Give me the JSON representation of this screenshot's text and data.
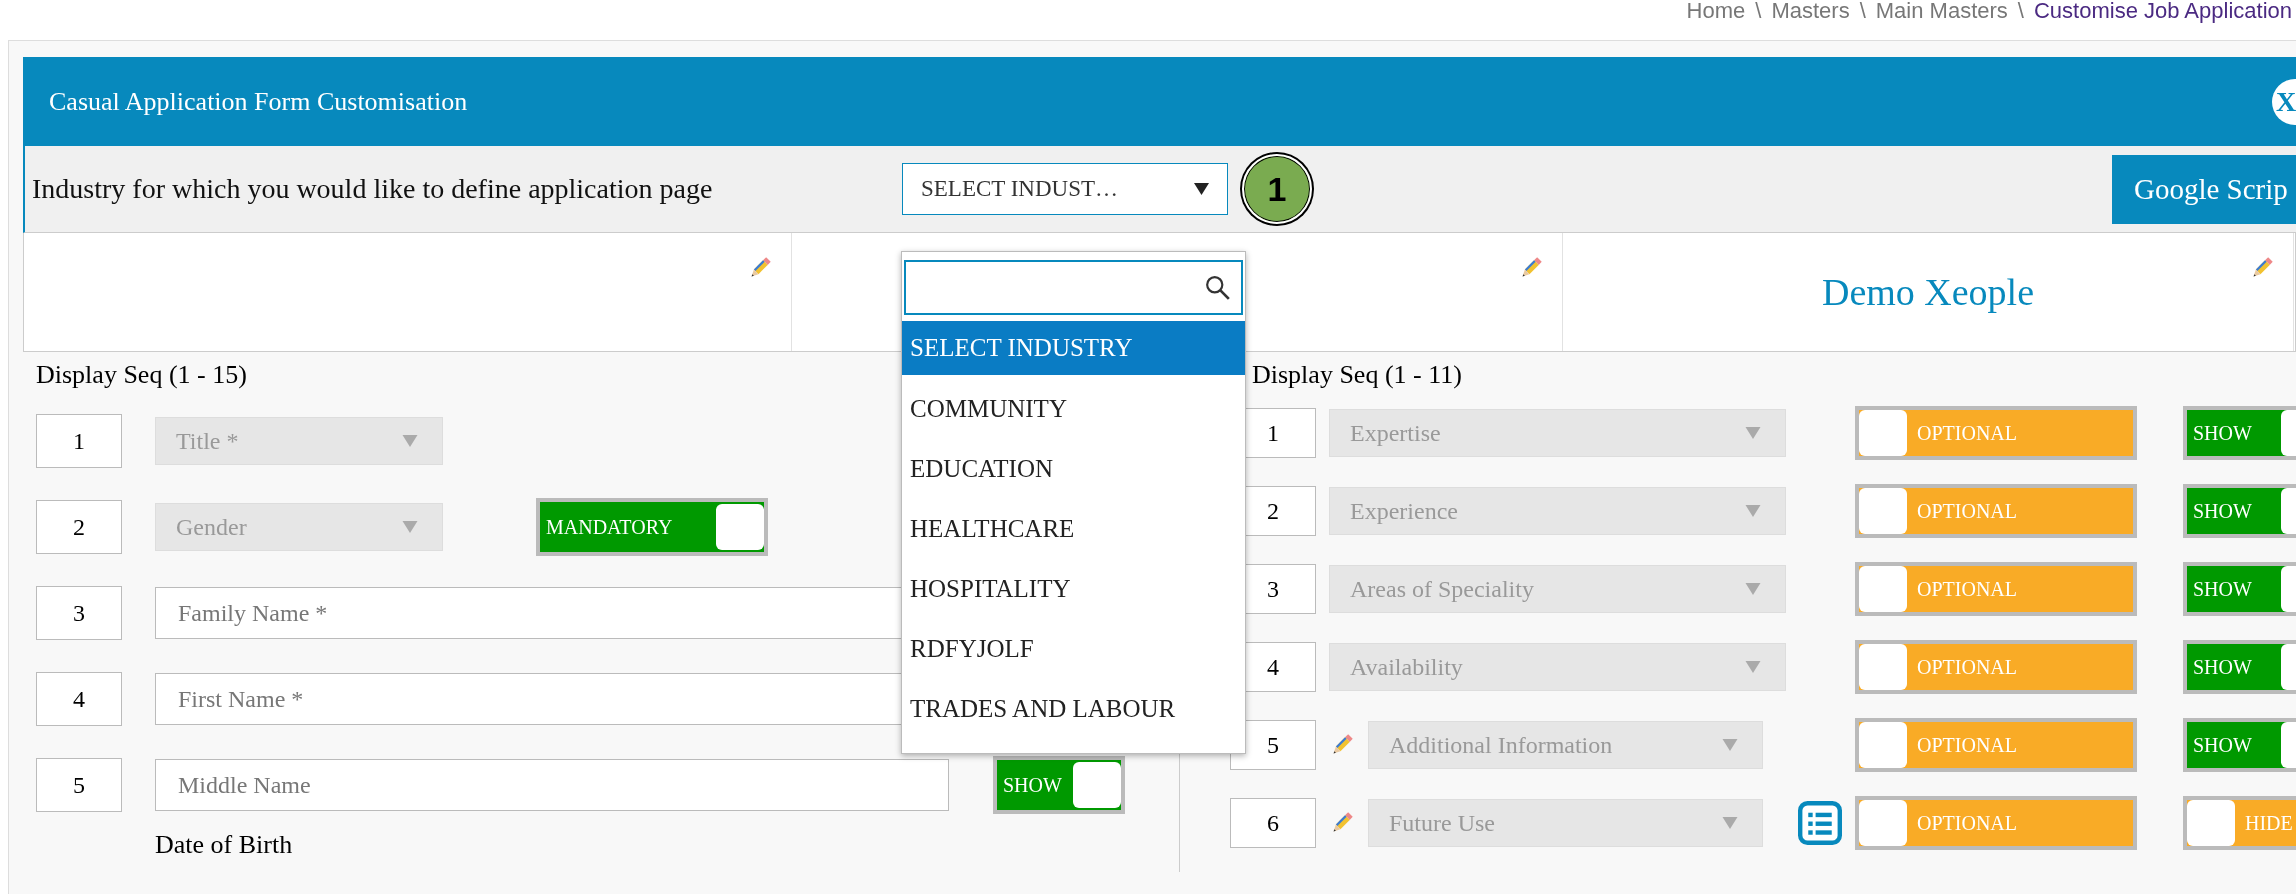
{
  "breadcrumb": [
    {
      "kind": "link",
      "label": "Home",
      "current": false
    },
    {
      "kind": "separator",
      "label": "\\"
    },
    {
      "kind": "link",
      "label": "Masters",
      "current": false
    },
    {
      "kind": "separator",
      "label": "\\"
    },
    {
      "kind": "link",
      "label": "Main Masters",
      "current": false
    },
    {
      "kind": "separator",
      "label": "\\"
    },
    {
      "kind": "link",
      "label": "Customise Job Application",
      "current": true
    }
  ],
  "panel": {
    "title": "Casual Application Form Customisation",
    "close": "X"
  },
  "industry": {
    "label": "Industry for which you would like to define application page",
    "value": "SELECT INDUST…",
    "expanded": true,
    "step": "1",
    "options": [
      {
        "label": "SELECT INDUSTRY",
        "selected": true
      },
      {
        "label": "COMMUNITY",
        "selected": false
      },
      {
        "label": "EDUCATION",
        "selected": false
      },
      {
        "label": "HEALTHCARE",
        "selected": false
      },
      {
        "label": "HOSPITALITY",
        "selected": false
      },
      {
        "label": "RDFYJOLF",
        "selected": false
      },
      {
        "label": "TRADES AND LABOUR",
        "selected": false
      }
    ]
  },
  "action_button": "Google Scrip",
  "header_cells": [
    {
      "kind": "blank"
    },
    {
      "kind": "blank"
    },
    {
      "kind": "title",
      "title": "Demo Xeople"
    }
  ],
  "left": {
    "heading": "Display Seq (1 - 15)",
    "rows": [
      {
        "seq": "1",
        "label": "Title *",
        "kind": "select"
      },
      {
        "seq": "2",
        "label": "Gender",
        "kind": "select",
        "requirement": {
          "text": "MANDATORY",
          "on": true
        }
      },
      {
        "seq": "3",
        "placeholder": "Family Name *",
        "kind": "text"
      },
      {
        "seq": "4",
        "placeholder": "First Name *",
        "kind": "text"
      },
      {
        "seq": "5",
        "placeholder": "Middle Name",
        "kind": "short_text",
        "visibility": {
          "text": "SHOW",
          "on": true
        }
      }
    ],
    "extra_label": "Date of Birth"
  },
  "right": {
    "heading": "Display Seq (1 - 11)",
    "rows": [
      {
        "seq": "1",
        "label": "Expertise",
        "editable": false,
        "options_list": false,
        "requirement": {
          "text": "OPTIONAL",
          "on": false
        },
        "visibility": {
          "text": "SHOW",
          "on": true
        }
      },
      {
        "seq": "2",
        "label": "Experience",
        "editable": false,
        "options_list": false,
        "requirement": {
          "text": "OPTIONAL",
          "on": false
        },
        "visibility": {
          "text": "SHOW",
          "on": true
        }
      },
      {
        "seq": "3",
        "label": "Areas of Speciality",
        "editable": false,
        "options_list": false,
        "requirement": {
          "text": "OPTIONAL",
          "on": false
        },
        "visibility": {
          "text": "SHOW",
          "on": true
        }
      },
      {
        "seq": "4",
        "label": "Availability",
        "editable": false,
        "options_list": false,
        "requirement": {
          "text": "OPTIONAL",
          "on": false
        },
        "visibility": {
          "text": "SHOW",
          "on": true
        }
      },
      {
        "seq": "5",
        "label": "Additional Information",
        "editable": true,
        "options_list": false,
        "requirement": {
          "text": "OPTIONAL",
          "on": false
        },
        "visibility": {
          "text": "SHOW",
          "on": true
        }
      },
      {
        "seq": "6",
        "label": "Future Use",
        "editable": true,
        "options_list": true,
        "requirement": {
          "text": "OPTIONAL",
          "on": false
        },
        "visibility": {
          "text": "HIDE",
          "on": false
        }
      }
    ]
  }
}
